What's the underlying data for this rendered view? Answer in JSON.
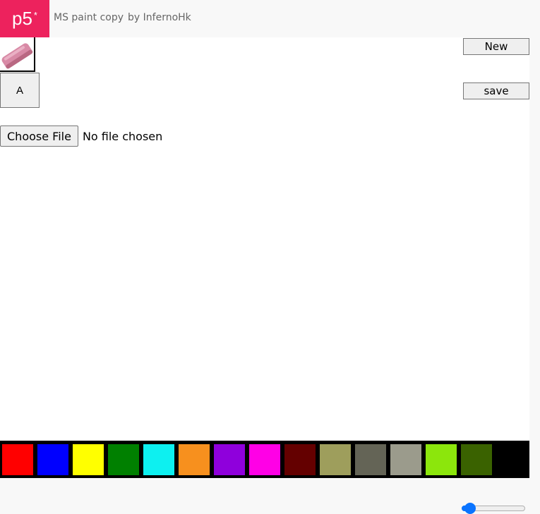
{
  "header": {
    "logo_text": "p5",
    "logo_sup": "*",
    "sketch_name": "MS paint copy",
    "author": "by InfernoHk"
  },
  "tools": {
    "eraser_icon": "eraser-icon",
    "text_tool_label": "A"
  },
  "actions": {
    "new_label": "New",
    "save_label": "save"
  },
  "file_input": {
    "button_label": "Choose File",
    "status": "No file chosen"
  },
  "palette": {
    "colors": [
      "#ff0000",
      "#0000ff",
      "#ffff00",
      "#008000",
      "#0df0f0",
      "#f7901e",
      "#8f00dc",
      "#ff00e6",
      "#640000",
      "#9e9e5c",
      "#646456",
      "#9b9b8c",
      "#8ce60c",
      "#3a6200",
      "#000000"
    ]
  },
  "brush_size": {
    "value_fraction": 0.06
  },
  "colors": {
    "brand": "#ed225d",
    "slider_accent": "#0a74ff"
  }
}
